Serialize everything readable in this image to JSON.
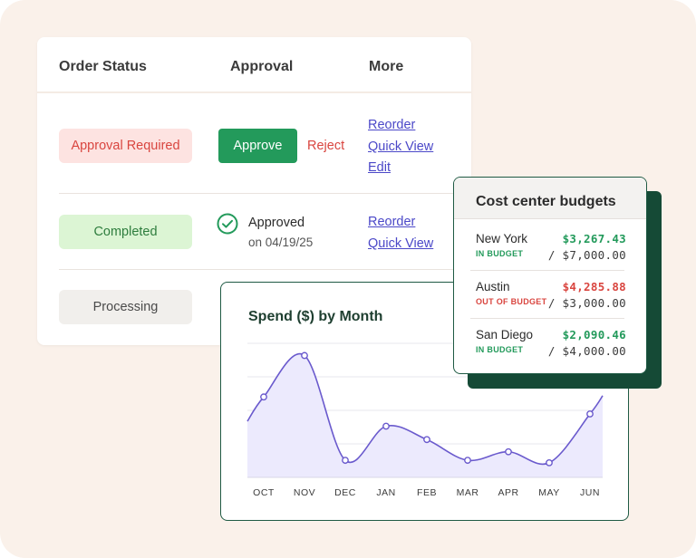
{
  "orders": {
    "headers": {
      "status": "Order Status",
      "approval": "Approval",
      "more": "More"
    },
    "rows": [
      {
        "status": "Approval Required",
        "approve_label": "Approve",
        "reject_label": "Reject",
        "links": [
          "Reorder",
          "Quick View",
          "Edit"
        ]
      },
      {
        "status": "Completed",
        "approved_label": "Approved",
        "approved_date": "on 04/19/25",
        "links": [
          "Reorder",
          "Quick View"
        ]
      },
      {
        "status": "Processing"
      }
    ]
  },
  "chart": {
    "title": "Spend ($) by Month",
    "line_color": "#6a5acd",
    "fill_color": "#eceafd"
  },
  "chart_data": {
    "type": "area",
    "title": "Spend ($) by Month",
    "categories": [
      "OCT",
      "NOV",
      "DEC",
      "JAN",
      "FEB",
      "MAR",
      "APR",
      "MAY",
      "JUN"
    ],
    "values": [
      0.66,
      1.0,
      0.14,
      0.42,
      0.31,
      0.14,
      0.21,
      0.12,
      0.52
    ],
    "xlabel": "",
    "ylabel": "",
    "ylim": [
      0,
      1.1
    ],
    "grid": true,
    "legend": "none"
  },
  "budgets": {
    "title": "Cost center budgets",
    "items": [
      {
        "city": "New York",
        "status": "IN BUDGET",
        "spent": "$3,267.43",
        "total": "/ $7,000.00",
        "status_color": "#239a5b"
      },
      {
        "city": "Austin",
        "status": "OUT OF BUDGET",
        "spent": "$4,285.88",
        "total": "/ $3,000.00",
        "status_color": "#d9453f"
      },
      {
        "city": "San Diego",
        "status": "IN BUDGET",
        "spent": "$2,090.46",
        "total": "/ $4,000.00",
        "status_color": "#239a5b"
      }
    ]
  }
}
